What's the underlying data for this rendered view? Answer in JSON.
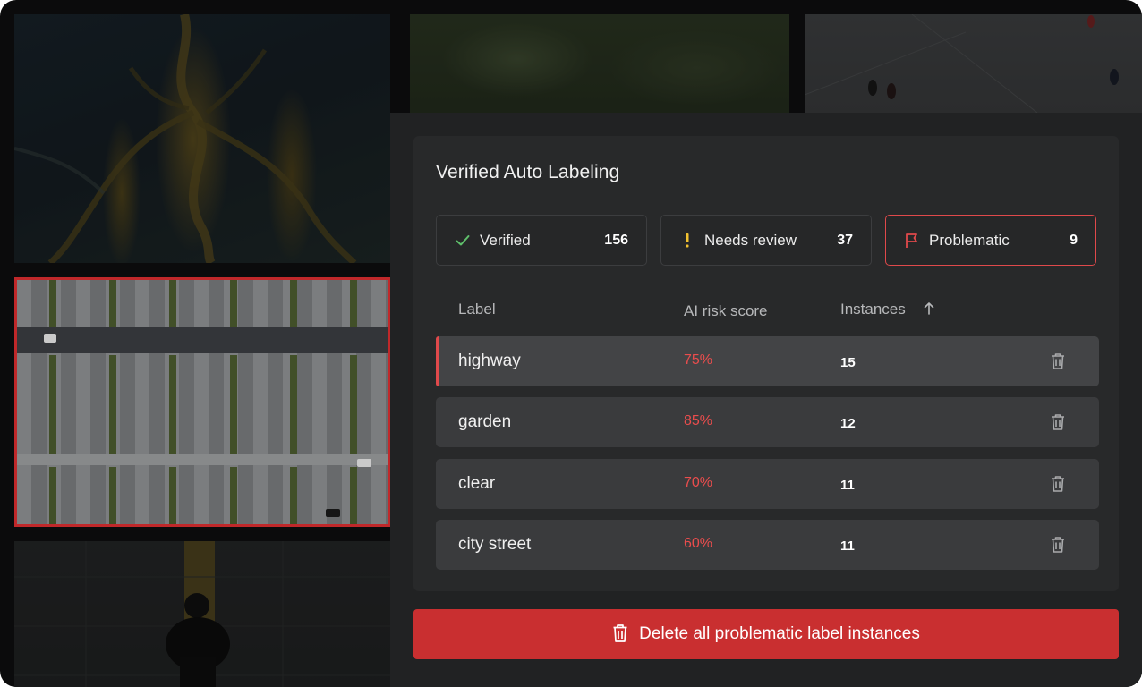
{
  "panel": {
    "title": "Verified Auto Labeling"
  },
  "filters": [
    {
      "label": "Verified",
      "count": "156",
      "icon": "check-icon",
      "color": "#5fbf6b"
    },
    {
      "label": "Needs review",
      "count": "37",
      "icon": "exclamation-icon",
      "color": "#f2c230"
    },
    {
      "label": "Problematic",
      "count": "9",
      "icon": "flag-icon",
      "color": "#e0494b",
      "selected": true
    }
  ],
  "table": {
    "columns": [
      "Label",
      "AI risk score",
      "Instances"
    ],
    "sort": {
      "column": "Instances",
      "direction": "ascending"
    },
    "rows": [
      {
        "label": "highway",
        "risk": "75%",
        "instances": "15",
        "active": true
      },
      {
        "label": "garden",
        "risk": "85%",
        "instances": "12"
      },
      {
        "label": "clear",
        "risk": "70%",
        "instances": "11"
      },
      {
        "label": "city street",
        "risk": "60%",
        "instances": "11"
      }
    ]
  },
  "actions": {
    "delete_all_label": "Delete all problematic label instances"
  },
  "colors": {
    "accent_red": "#c92f30",
    "risk_text": "#ea4d4d",
    "selected_border": "#e0494b"
  }
}
